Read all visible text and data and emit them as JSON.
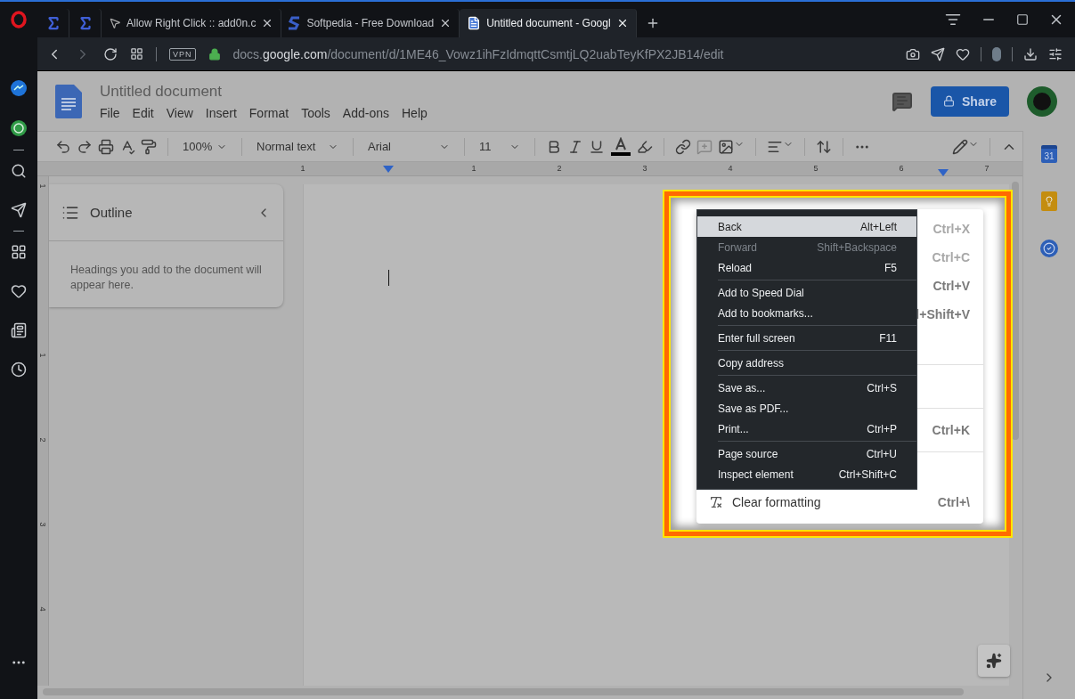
{
  "browser": {
    "tabs": [
      {
        "kind": "pinned",
        "selected": false
      },
      {
        "kind": "pinned",
        "selected": false
      },
      {
        "kind": "page",
        "title": "Allow Right Click :: add0n.c",
        "selected": false
      },
      {
        "kind": "page",
        "title": "Softpedia - Free Download",
        "selected": false
      },
      {
        "kind": "page",
        "title": "Untitled document - Googl",
        "selected": true
      }
    ],
    "address_bar": {
      "vpn_label": "VPN",
      "url_prefix": "docs.",
      "url_domain": "google.com",
      "url_path": "/document/d/1ME46_Vowz1ihFzIdmqttCsmtjLQ2uabTeyKfPX2JB14/edit",
      "forward_disabled": true
    }
  },
  "docs": {
    "title": "Untitled document",
    "menu": [
      "File",
      "Edit",
      "View",
      "Insert",
      "Format",
      "Tools",
      "Add-ons",
      "Help"
    ],
    "share_label": "Share",
    "toolbar": {
      "zoom": "100%",
      "style": "Normal text",
      "font": "Arial",
      "size": "11"
    },
    "ruler_labels": [
      "1",
      "1",
      "2",
      "3",
      "4",
      "5",
      "6",
      "7"
    ],
    "vertical_ruler_labels": [
      "1",
      "1",
      "2",
      "3",
      "4"
    ],
    "calendar_day": "31",
    "outline": {
      "title": "Outline",
      "hint": "Headings you add to the document will appear here."
    }
  },
  "docs_context_menu": [
    {
      "kind": "item",
      "shortcut": "Ctrl+X",
      "disabled": true
    },
    {
      "kind": "item",
      "shortcut": "Ctrl+C",
      "disabled": true
    },
    {
      "kind": "item",
      "shortcut": "Ctrl+V",
      "disabled": false
    },
    {
      "kind": "item",
      "shortcut": "l+Shift+V",
      "disabled": false
    },
    {
      "kind": "blank"
    },
    {
      "kind": "separator"
    },
    {
      "kind": "blank"
    },
    {
      "kind": "separator"
    },
    {
      "kind": "item",
      "shortcut": "Ctrl+K",
      "disabled": false
    },
    {
      "kind": "separator"
    },
    {
      "kind": "blank"
    },
    {
      "kind": "item",
      "label": "Clear formatting",
      "shortcut": "Ctrl+\\",
      "disabled": false
    }
  ],
  "browser_context_menu": [
    {
      "kind": "item",
      "label": "Back",
      "shortcut": "Alt+Left",
      "selected": true,
      "disabled": false
    },
    {
      "kind": "item",
      "label": "Forward",
      "shortcut": "Shift+Backspace",
      "selected": false,
      "disabled": true
    },
    {
      "kind": "item",
      "label": "Reload",
      "shortcut": "F5",
      "selected": false,
      "disabled": false
    },
    {
      "kind": "separator"
    },
    {
      "kind": "item",
      "label": "Add to Speed Dial",
      "selected": false,
      "disabled": false
    },
    {
      "kind": "item",
      "label": "Add to bookmarks...",
      "selected": false,
      "disabled": false
    },
    {
      "kind": "separator"
    },
    {
      "kind": "item",
      "label": "Enter full screen",
      "shortcut": "F11",
      "selected": false,
      "disabled": false
    },
    {
      "kind": "separator"
    },
    {
      "kind": "item",
      "label": "Copy address",
      "selected": false,
      "disabled": false
    },
    {
      "kind": "separator"
    },
    {
      "kind": "item",
      "label": "Save as...",
      "shortcut": "Ctrl+S",
      "selected": false,
      "disabled": false
    },
    {
      "kind": "item",
      "label": "Save as PDF...",
      "selected": false,
      "disabled": false
    },
    {
      "kind": "item",
      "label": "Print...",
      "shortcut": "Ctrl+P",
      "selected": false,
      "disabled": false
    },
    {
      "kind": "separator"
    },
    {
      "kind": "item",
      "label": "Page source",
      "shortcut": "Ctrl+U",
      "selected": false,
      "disabled": false
    },
    {
      "kind": "item",
      "label": "Inspect element",
      "shortcut": "Ctrl+Shift+C",
      "selected": false,
      "disabled": false
    }
  ]
}
